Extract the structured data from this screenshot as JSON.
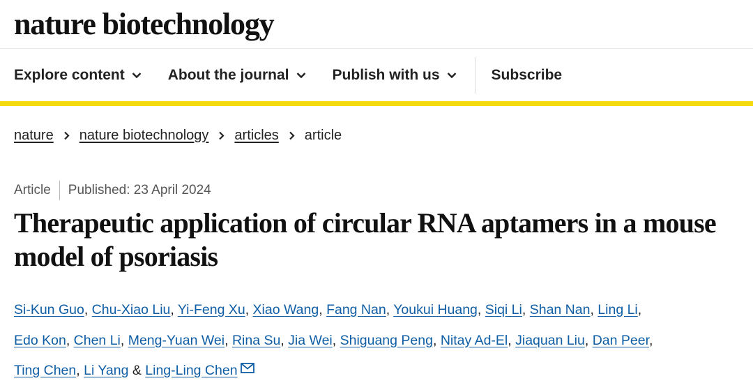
{
  "brand": {
    "name": "nature biotechnology"
  },
  "nav": {
    "items": [
      {
        "label": "Explore content",
        "icon": "chevron-down-icon"
      },
      {
        "label": "About the journal",
        "icon": "chevron-down-icon"
      },
      {
        "label": "Publish with us",
        "icon": "chevron-down-icon"
      }
    ],
    "subscribe": "Subscribe",
    "accent_color": "#f4db0f"
  },
  "breadcrumb": {
    "items": [
      "nature",
      "nature biotechnology",
      "articles"
    ],
    "current": "article",
    "separator_icon": "chevron-right-icon"
  },
  "article": {
    "type": "Article",
    "published": "Published: 23 April 2024",
    "title": "Therapeutic application of circular RNA aptamers in a mouse model of psoriasis",
    "authors": [
      "Si-Kun Guo",
      "Chu-Xiao Liu",
      "Yi-Feng Xu",
      "Xiao Wang",
      "Fang Nan",
      "Youkui Huang",
      "Siqi Li",
      "Shan Nan",
      "Ling Li",
      "Edo Kon",
      "Chen Li",
      "Meng-Yuan Wei",
      "Rina Su",
      "Jia Wei",
      "Shiguang Peng",
      "Nitay Ad-El",
      "Jiaquan Liu",
      "Dan Peer",
      "Ting Chen",
      "Li Yang",
      "Ling-Ling Chen"
    ],
    "author_link_color": "#0f5ea5",
    "corresponding_icon": "mail-icon"
  }
}
